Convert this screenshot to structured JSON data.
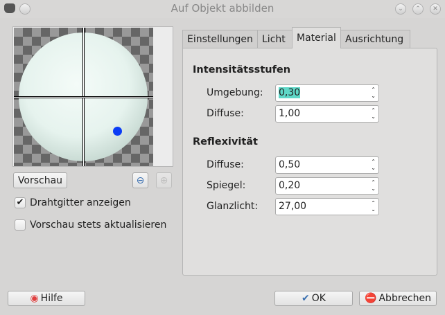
{
  "window": {
    "title": "Auf Objekt abbilden"
  },
  "preview": {
    "button": "Vorschau",
    "wireframe_label": "Drahtgitter anzeigen",
    "wireframe_checked": true,
    "autoupdate_label": "Vorschau stets aktualisieren",
    "autoupdate_checked": false
  },
  "tabs": [
    {
      "label": "Einstellungen"
    },
    {
      "label": "Licht"
    },
    {
      "label": "Material",
      "active": true
    },
    {
      "label": "Ausrichtung"
    }
  ],
  "material": {
    "intensity_title": "Intensitätsstufen",
    "ambient_label": "Umgebung:",
    "ambient_value": "0,30",
    "diffuse_label": "Diffuse:",
    "diffuse_value": "1,00",
    "reflect_title": "Reflexivität",
    "rdiffuse_label": "Diffuse:",
    "rdiffuse_value": "0,50",
    "specular_label": "Spiegel:",
    "specular_value": "0,20",
    "highlight_label": "Glanzlicht:",
    "highlight_value": "27,00"
  },
  "buttons": {
    "help": "Hilfe",
    "ok": "OK",
    "cancel": "Abbrechen"
  }
}
